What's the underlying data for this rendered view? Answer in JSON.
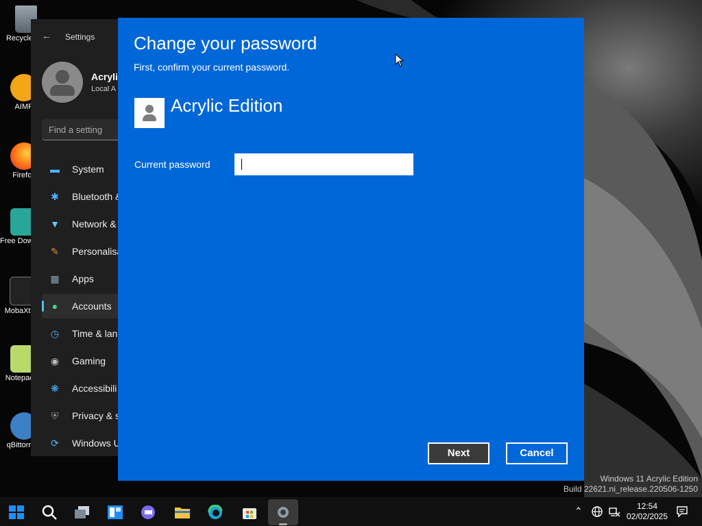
{
  "desktop": {
    "icons": [
      {
        "label": "Recycle Bin"
      },
      {
        "label": "AIMP"
      },
      {
        "label": "Firefox"
      },
      {
        "label": "Free Download"
      },
      {
        "label": "MobaXterm"
      },
      {
        "label": "Notepad++"
      },
      {
        "label": "qBittorrent"
      }
    ],
    "watermark": {
      "line1": "Windows 11 Acrylic Edition",
      "line2": "Build 22621.ni_release.220506-1250"
    }
  },
  "settings": {
    "app_title": "Settings",
    "user_name": "Acrylic",
    "user_sub": "Local A",
    "search_placeholder": "Find a setting",
    "nav": [
      {
        "label": "System",
        "icon": "monitor-icon"
      },
      {
        "label": "Bluetooth &",
        "icon": "bluetooth-icon"
      },
      {
        "label": "Network &",
        "icon": "wifi-icon"
      },
      {
        "label": "Personalisa",
        "icon": "brush-icon"
      },
      {
        "label": "Apps",
        "icon": "apps-icon"
      },
      {
        "label": "Accounts",
        "icon": "person-icon",
        "selected": true
      },
      {
        "label": "Time & lan",
        "icon": "clock-icon"
      },
      {
        "label": "Gaming",
        "icon": "gamepad-icon"
      },
      {
        "label": "Accessibili",
        "icon": "accessibility-icon"
      },
      {
        "label": "Privacy & s",
        "icon": "shield-icon"
      },
      {
        "label": "Windows U",
        "icon": "update-icon"
      }
    ]
  },
  "dialog": {
    "title": "Change your password",
    "subtitle": "First, confirm your current password.",
    "account_name": "Acrylic Edition",
    "current_password_label": "Current password",
    "current_password_value": "",
    "next_label": "Next",
    "cancel_label": "Cancel",
    "background_color": "#0067d8"
  },
  "taskbar": {
    "buttons": [
      {
        "name": "start-button",
        "icon": "windows-logo-icon"
      },
      {
        "name": "search-button",
        "icon": "search-icon"
      },
      {
        "name": "task-view-button",
        "icon": "task-view-icon"
      },
      {
        "name": "widgets-button",
        "icon": "widgets-icon"
      },
      {
        "name": "chat-button",
        "icon": "chat-icon"
      },
      {
        "name": "file-explorer-button",
        "icon": "folder-icon"
      },
      {
        "name": "edge-button",
        "icon": "edge-icon"
      },
      {
        "name": "store-button",
        "icon": "store-icon"
      },
      {
        "name": "settings-taskbar-button",
        "icon": "gear-icon",
        "active": true
      }
    ],
    "clock_time": "12:54",
    "clock_date": "02/02/2025"
  }
}
